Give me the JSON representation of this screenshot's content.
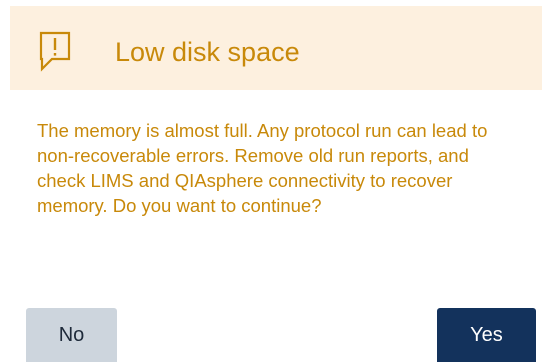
{
  "dialog": {
    "title": "Low disk space",
    "icon": "speech-bubble-exclamation-icon",
    "message": "The memory is almost full. Any protocol run can lead to non-recoverable errors. Remove old run reports, and check LIMS and QIAsphere connectivity to recover memory. Do you want to continue?",
    "buttons": {
      "no_label": "No",
      "yes_label": "Yes"
    }
  },
  "colors": {
    "accent": "#c8890a",
    "header_bg": "#fdf0df",
    "no_button_bg": "#cdd5dd",
    "yes_button_bg": "#13325c"
  }
}
